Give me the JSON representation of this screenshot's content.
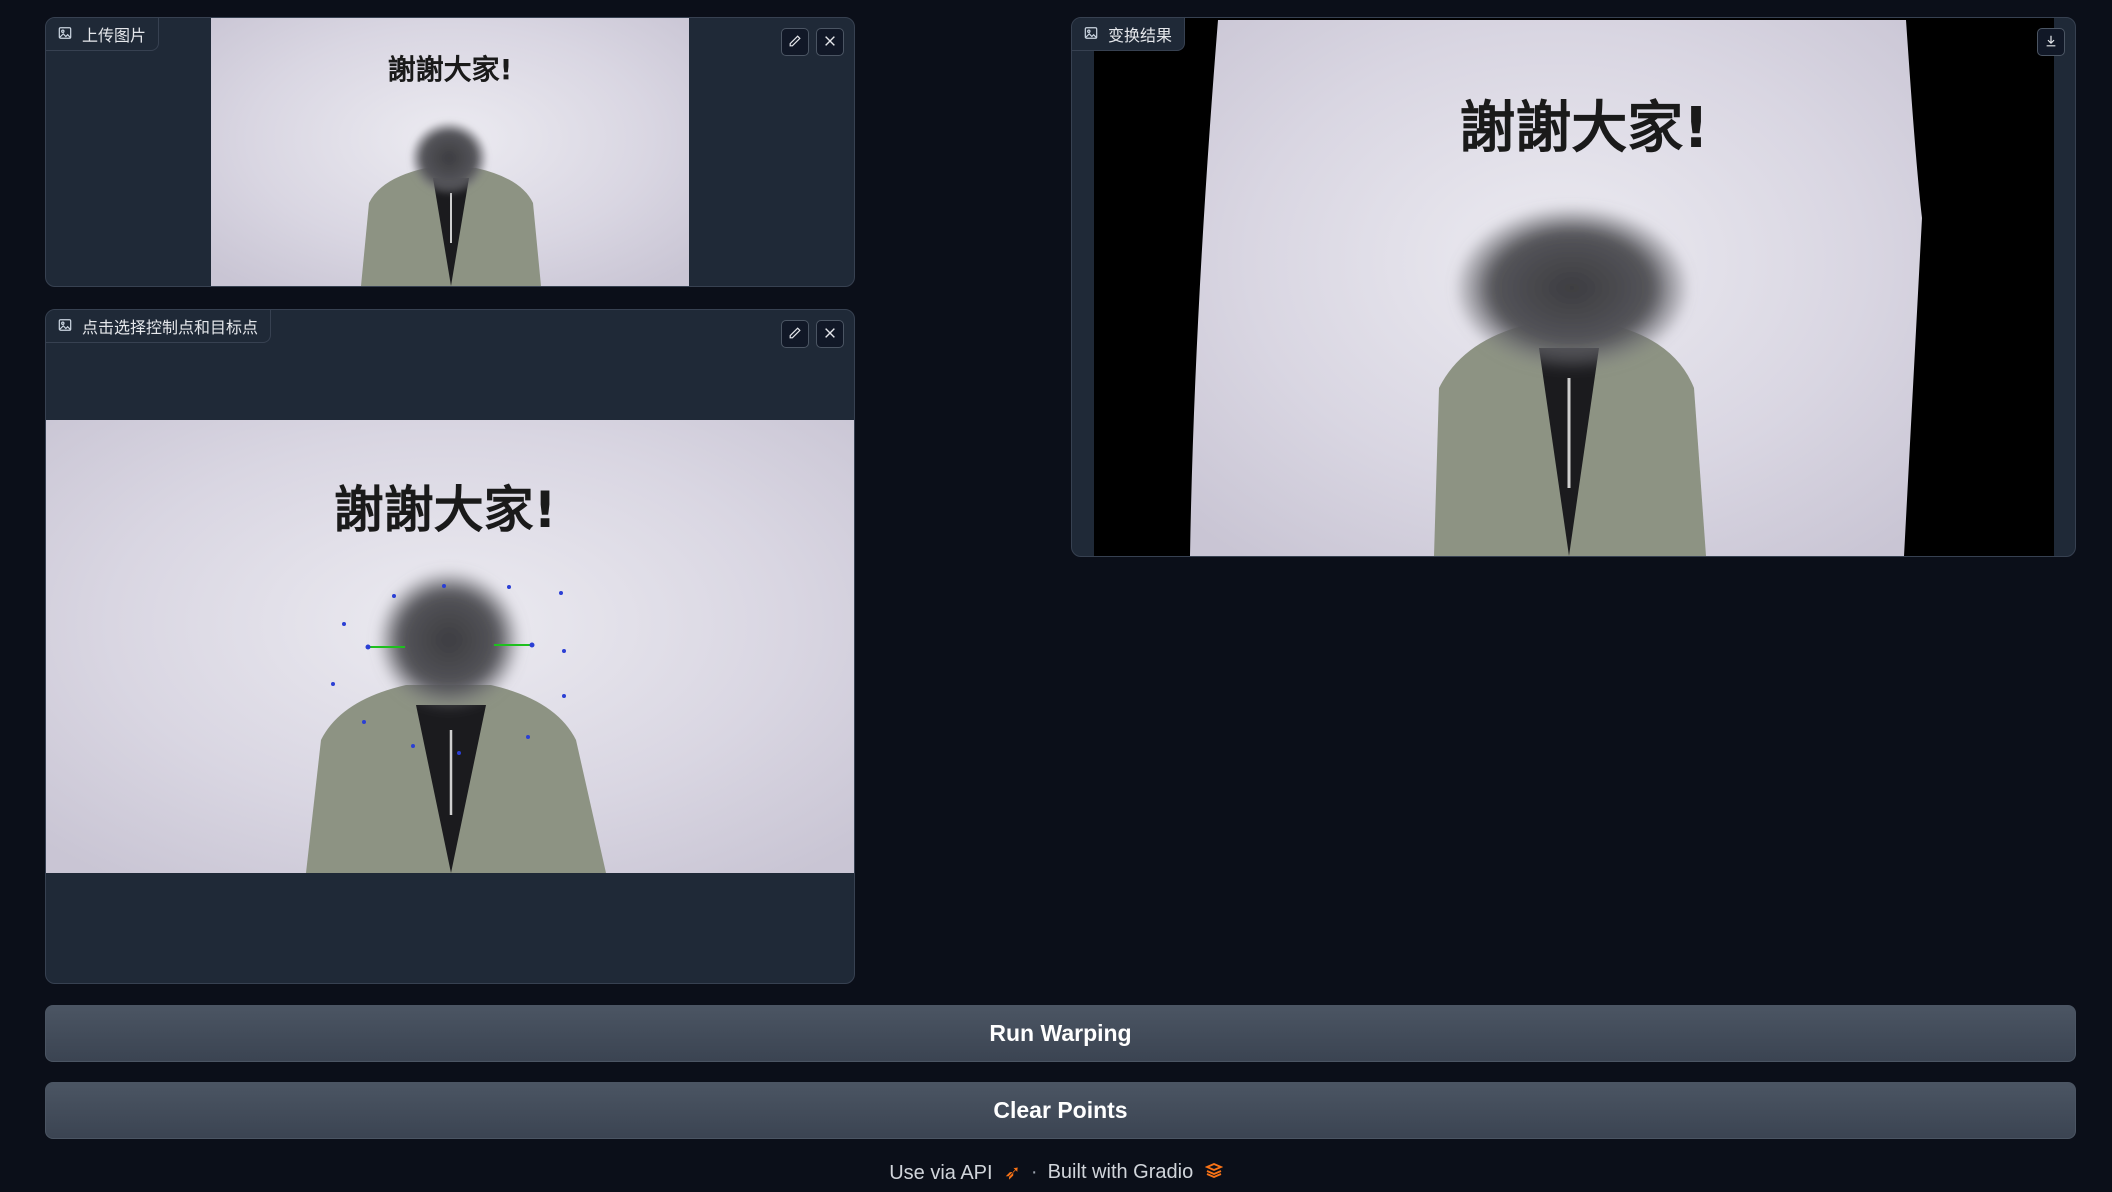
{
  "upload_panel": {
    "label": "上传图片",
    "image_caption": "謝謝大家!"
  },
  "select_panel": {
    "label": "点击选择控制点和目标点",
    "image_caption": "謝謝大家!"
  },
  "result_panel": {
    "label": "变换结果",
    "image_caption": "謝謝大家!"
  },
  "buttons": {
    "run": "Run Warping",
    "clear": "Clear Points"
  },
  "footer": {
    "api": "Use via API",
    "separator": "·",
    "built": "Built with Gradio"
  },
  "colors": {
    "background": "#0b0f19",
    "panel": "#1f2937",
    "border": "#374151",
    "button": "#4b5563",
    "control_point": "#2b3fd4",
    "target_line": "#1fc01f",
    "gradio_orange": "#f97316"
  },
  "icons": {
    "image": "image-icon",
    "edit": "pencil-icon",
    "clear": "close-icon",
    "download": "download-icon",
    "api": "rocket-icon",
    "gradio": "gradio-logo-icon"
  }
}
